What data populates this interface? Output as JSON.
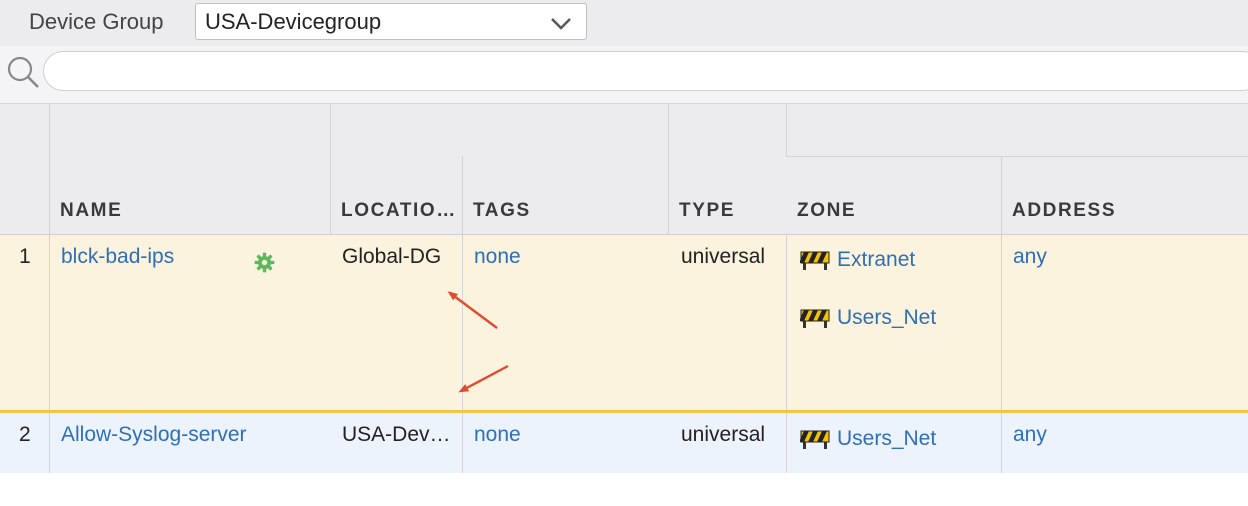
{
  "topbar": {
    "device_group_label": "Device Group",
    "device_group_value": "USA-Devicegroup"
  },
  "search": {
    "placeholder": "",
    "value": ""
  },
  "table": {
    "columns": [
      "NAME",
      "LOCATIO…",
      "TAGS",
      "TYPE",
      "ZONE",
      "ADDRESS"
    ],
    "rows": [
      {
        "index": "1",
        "name": "blck-bad-ips",
        "location": "Global-DG",
        "tags": "none",
        "type": "universal",
        "zones": [
          "Extranet",
          "Users_Net"
        ],
        "address": "any"
      },
      {
        "index": "2",
        "name": "Allow-Syslog-server",
        "location": "USA-Dev…",
        "tags": "none",
        "type": "universal",
        "zones": [
          "Users_Net"
        ],
        "address": "any"
      }
    ]
  },
  "colors": {
    "link": "#2e6fb8",
    "row1_bg": "#fbf3dd",
    "row1_border": "#f0c848",
    "row2_bg": "#edf3fc",
    "arrow": "#e04a2e",
    "gear": "#5cb85c"
  },
  "icons": {
    "search": "magnifier-icon",
    "chevron": "chevron-down-icon",
    "zone": "zone-barrier-icon",
    "rule_gear": "gear-icon",
    "annotation": "red-arrow-annotation"
  }
}
